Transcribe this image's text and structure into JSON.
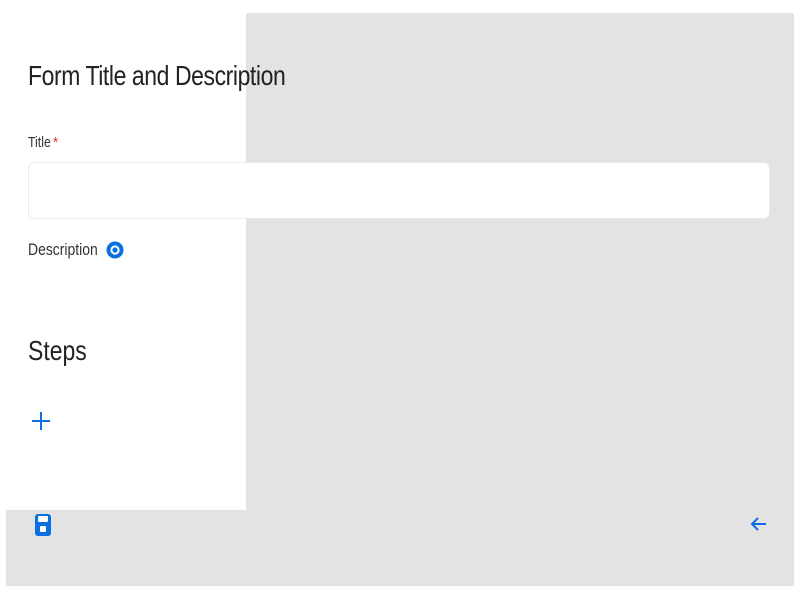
{
  "form": {
    "heading": "Form Title and Description",
    "title_label": "Title",
    "required_marker": "*",
    "title_value": "",
    "description_label": "Description"
  },
  "steps": {
    "heading": "Steps"
  },
  "icons": {
    "help": "help-circle-icon",
    "add": "plus-icon",
    "save": "save-icon",
    "back": "arrow-left-icon"
  },
  "colors": {
    "accent": "#0a6fe0",
    "required": "#e0342c",
    "background": "#e3e3e3",
    "panel": "#ffffff"
  }
}
